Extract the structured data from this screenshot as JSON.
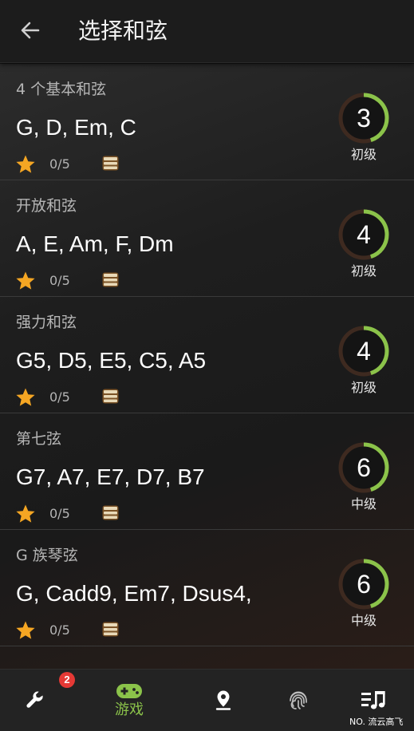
{
  "header": {
    "back_icon": "arrow-left-icon",
    "title": "选择和弦"
  },
  "lessons": [
    {
      "subtitle": "4 个基本和弦",
      "chords": "G, D, Em, C",
      "score": "0/5",
      "level_number": "3",
      "level_label": "初级",
      "progress": 0.45
    },
    {
      "subtitle": "开放和弦",
      "chords": "A, E, Am, F, Dm",
      "score": "0/5",
      "level_number": "4",
      "level_label": "初级",
      "progress": 0.45
    },
    {
      "subtitle": "强力和弦",
      "chords": "G5, D5, E5, C5, A5",
      "score": "0/5",
      "level_number": "4",
      "level_label": "初级",
      "progress": 0.45
    },
    {
      "subtitle": "第七弦",
      "chords": "G7, A7, E7, D7, B7",
      "score": "0/5",
      "level_number": "6",
      "level_label": "中级",
      "progress": 0.45
    },
    {
      "subtitle": "G 族琴弦",
      "chords": "G, Cadd9, Em7, Dsus4,",
      "score": "0/5",
      "level_number": "6",
      "level_label": "中级",
      "progress": 0.45
    }
  ],
  "bottom_nav": {
    "tools": {
      "icon": "wrench-icon",
      "badge": "2"
    },
    "games": {
      "icon": "gamepad-icon",
      "label": "游戏"
    },
    "map": {
      "icon": "location-pin-icon"
    },
    "fingerprint": {
      "icon": "fingerprint-icon"
    },
    "songs": {
      "icon": "music-list-icon"
    }
  },
  "watermark": "NO. 流云高飞",
  "colors": {
    "accent_green": "#8bc34a",
    "star": "#f5a623",
    "badge_red": "#e53935",
    "ring_track": "#3e2a20"
  }
}
